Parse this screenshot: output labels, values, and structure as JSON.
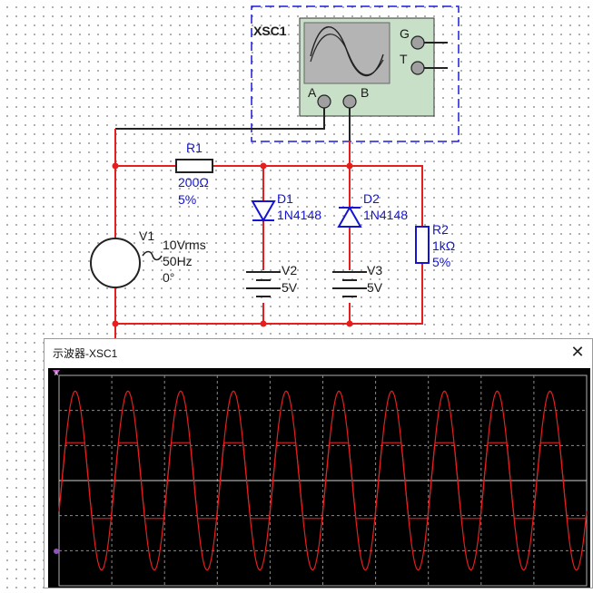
{
  "schematic": {
    "oscilloscope": {
      "name": "XSC1",
      "channel_a": "A",
      "channel_b": "B",
      "ground": "G",
      "trigger": "T"
    },
    "r1": {
      "name": "R1",
      "value": "200Ω",
      "tolerance": "5%"
    },
    "d1": {
      "name": "D1",
      "model": "1N4148"
    },
    "d2": {
      "name": "D2",
      "model": "1N4148"
    },
    "r2": {
      "name": "R2",
      "value": "1kΩ",
      "tolerance": "5%"
    },
    "v1": {
      "name": "V1",
      "amplitude": "10Vrms",
      "frequency": "50Hz",
      "phase": "0°"
    },
    "v2": {
      "name": "V2",
      "value": "5V"
    },
    "v3": {
      "name": "V3",
      "value": "5V"
    }
  },
  "scope_window": {
    "title": "示波器-XSC1",
    "close_symbol": "✕",
    "channel_a_marker": "A",
    "channel_b_marker": "B"
  },
  "colors": {
    "wire": "#e61e1e",
    "component_label": "#1414d2",
    "scope_background": "#000000",
    "scope_grid": "#8a8a8a",
    "trace": "#e61e1e",
    "scope_body": "#c8e0c8"
  },
  "waveform": {
    "cycles_visible": 10,
    "channel_a": {
      "shape": "sine",
      "peak_fraction_of_screen": 0.85
    },
    "channel_b": {
      "shape": "clipped sine",
      "clip_level_fraction_of_screen": 0.36
    }
  }
}
